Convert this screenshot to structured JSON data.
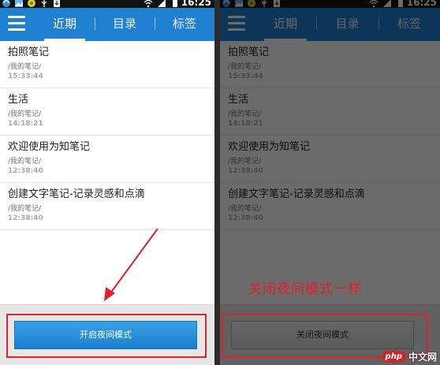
{
  "status_bar": {
    "time": "16:25"
  },
  "tabs": [
    {
      "label": "近期",
      "active": true
    },
    {
      "label": "目录",
      "active": false
    },
    {
      "label": "标签",
      "active": false
    }
  ],
  "notes": [
    {
      "title": "拍照笔记",
      "path": "/我的笔记/",
      "time": "15:33:44"
    },
    {
      "title": "生活",
      "path": "/我的笔记/",
      "time": "14:18:21"
    },
    {
      "title": "欢迎使用为知笔记",
      "path": "/我的笔记/",
      "time": "12:38:40"
    },
    {
      "title": "创建文字笔记-记录灵感和点滴",
      "path": "/我的笔记/",
      "time": "12:38:40"
    }
  ],
  "left_panel": {
    "button_label": "开启夜间模式"
  },
  "right_panel": {
    "button_label": "关闭夜间模式",
    "annotation": "关闭夜间模式一样"
  },
  "watermark": {
    "logo": "php",
    "text": "中文网"
  },
  "colors": {
    "header": "#1f7fd1",
    "highlight": "#e0202a",
    "night_overlay": "rgba(0,0,0,0.58)"
  }
}
